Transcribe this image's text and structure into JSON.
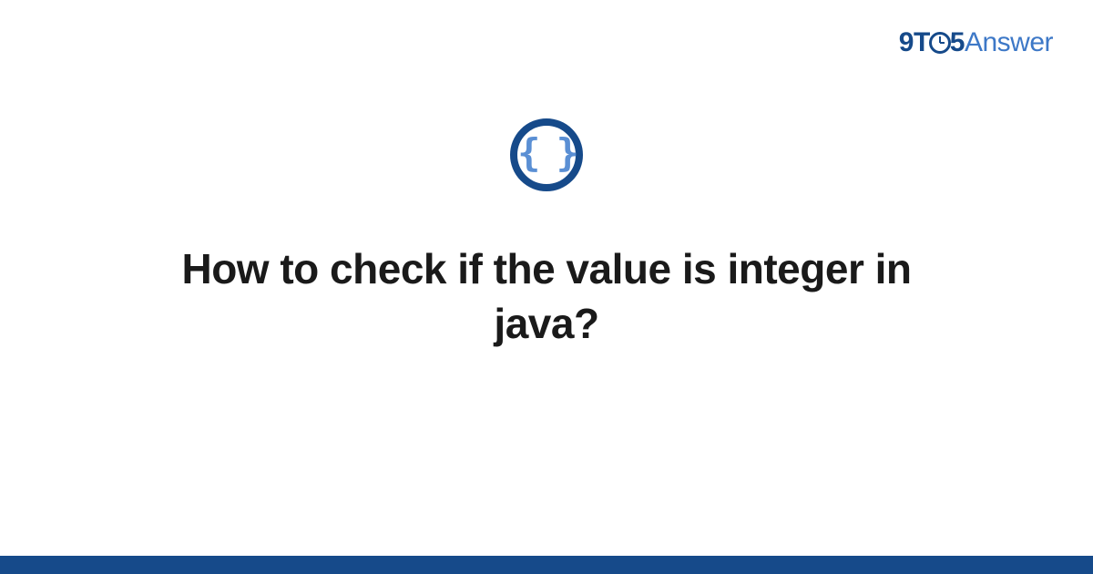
{
  "logo": {
    "part1": "9",
    "part2": "T",
    "part3": "5",
    "part4": "Answer"
  },
  "icon": {
    "braces": "{ }"
  },
  "title": "How to check if the value is integer in java?"
}
